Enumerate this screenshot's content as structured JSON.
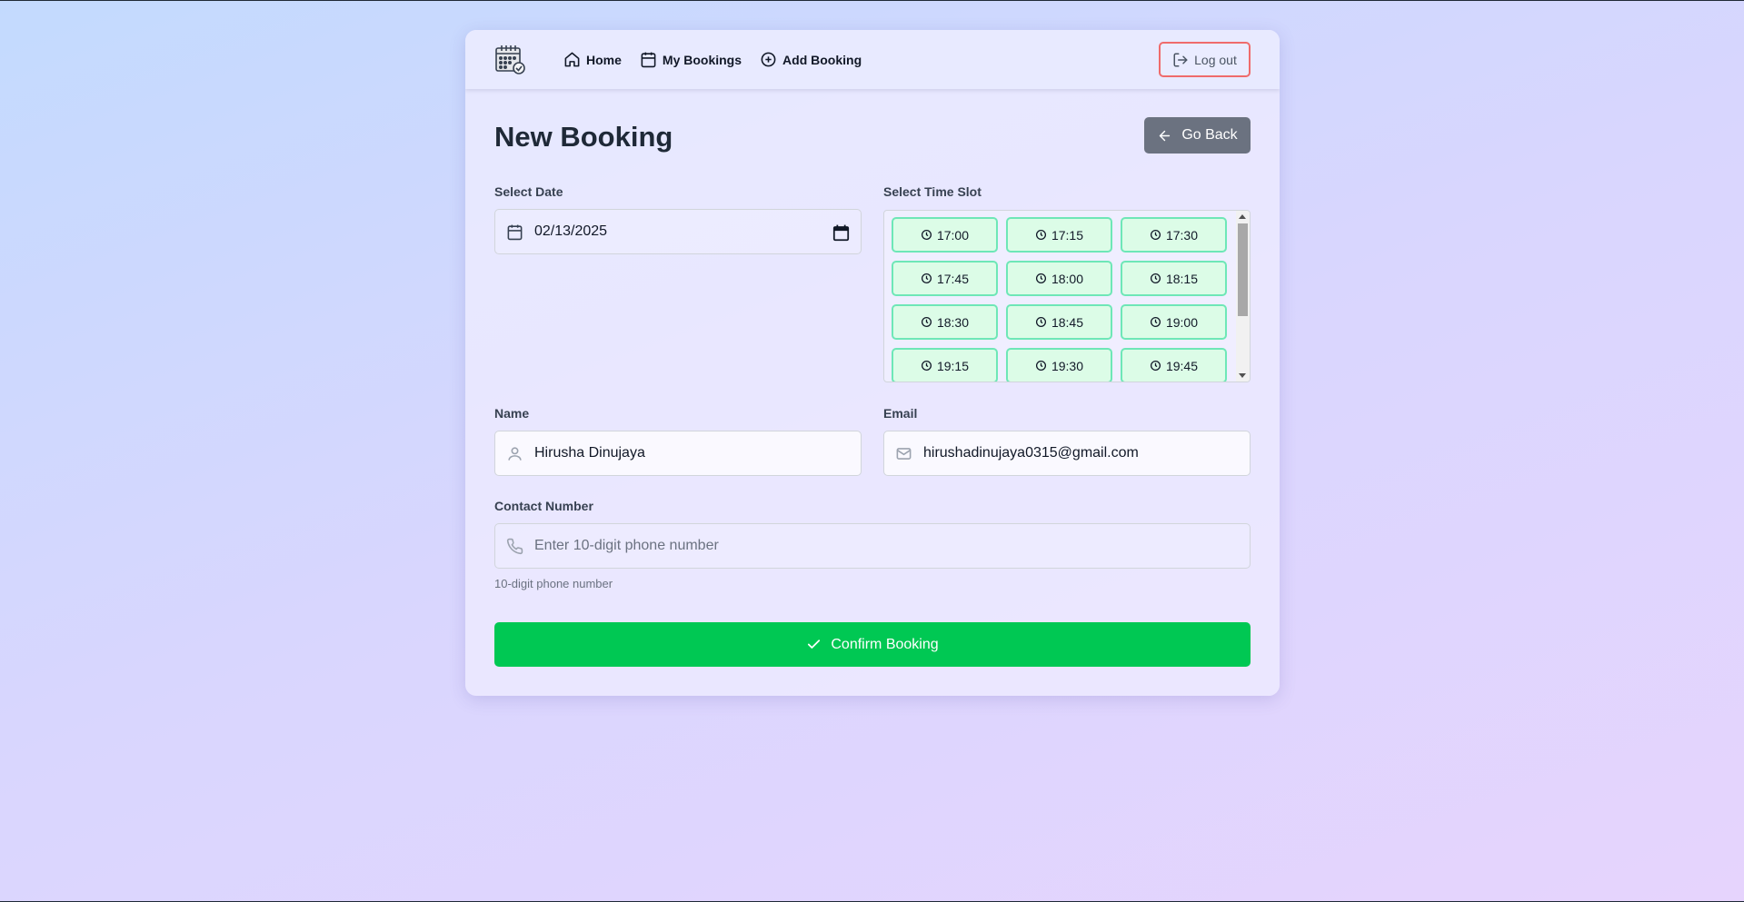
{
  "nav": {
    "home": "Home",
    "my_bookings": "My Bookings",
    "add_booking": "Add Booking",
    "logout": "Log out"
  },
  "page": {
    "title": "New Booking",
    "go_back": "Go Back"
  },
  "date": {
    "label": "Select Date",
    "value": "02/13/2025"
  },
  "timeslots": {
    "label": "Select Time Slot",
    "slots": [
      "17:00",
      "17:15",
      "17:30",
      "17:45",
      "18:00",
      "18:15",
      "18:30",
      "18:45",
      "19:00",
      "19:15",
      "19:30",
      "19:45"
    ]
  },
  "name": {
    "label": "Name",
    "value": "Hirusha Dinujaya"
  },
  "email": {
    "label": "Email",
    "value": "hirushadinujaya0315@gmail.com"
  },
  "contact": {
    "label": "Contact Number",
    "placeholder": "Enter 10-digit phone number",
    "hint": "10-digit phone number"
  },
  "confirm": "Confirm Booking",
  "icons": {
    "logo": "calendar-check-icon",
    "home": "home-icon",
    "bookings": "calendar-icon",
    "add": "plus-circle-icon",
    "logout": "log-out-icon",
    "back": "arrow-left-icon",
    "slot": "clock-icon",
    "user": "user-icon",
    "mail": "mail-icon",
    "phone": "phone-icon",
    "confirm": "check-icon"
  },
  "colors": {
    "confirm": "#00c853",
    "slot_bg": "#dcfce7",
    "slot_border": "#6ee7b7",
    "logout_border": "#ef6b6b",
    "go_back": "#6b7280"
  }
}
